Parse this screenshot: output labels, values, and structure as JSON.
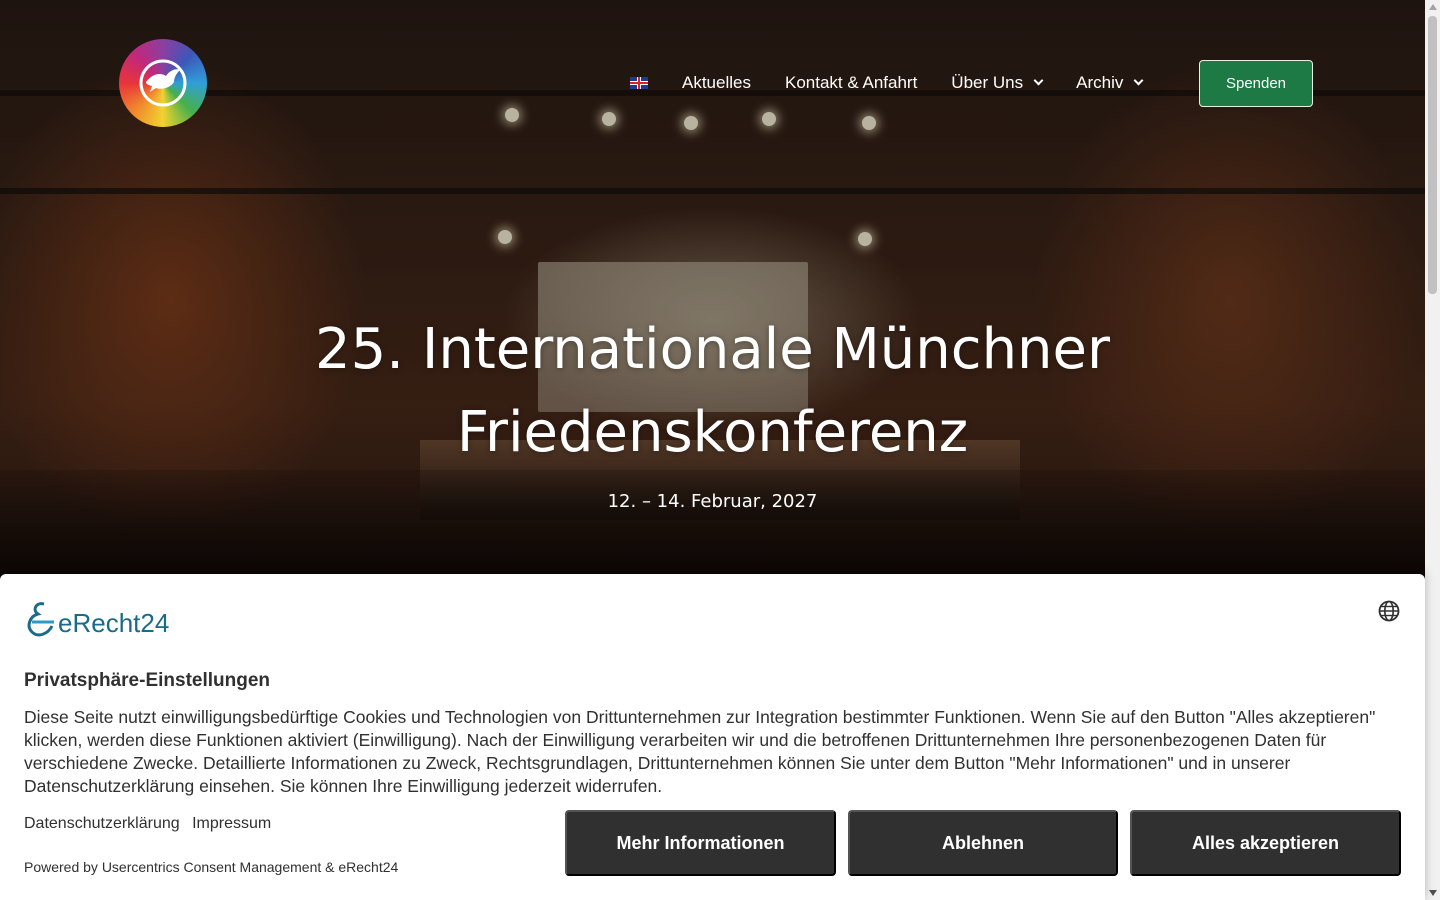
{
  "header": {
    "logo_icon": "peace-dove-logo-icon",
    "language_flag_icon": "uk-flag-icon",
    "nav": [
      {
        "label": "Aktuelles",
        "has_dropdown": false
      },
      {
        "label": "Kontakt & Anfahrt",
        "has_dropdown": false
      },
      {
        "label": "Über Uns",
        "has_dropdown": true
      },
      {
        "label": "Archiv",
        "has_dropdown": true
      }
    ],
    "donate_label": "Spenden"
  },
  "hero": {
    "title_line1": "25. Internationale Münchner",
    "title_line2": "Friedenskonferenz",
    "date": "12. – 14. Februar, 2027"
  },
  "consent": {
    "brand_name": "eRecht24",
    "language_icon": "globe-icon",
    "title": "Privatsphäre-Einstellungen",
    "description": "Diese Seite nutzt einwilligungsbedürftige Cookies und Technologien von Drittunternehmen zur Integration bestimmter Funktionen. Wenn Sie auf den Button \"Alles akzeptieren\" klicken, werden diese Funktionen aktiviert (Einwilligung). Nach der Einwilligung verarbeiten wir und die betroffenen Drittunternehmen Ihre personenbezogenen Daten für verschiedene Zwecke. Detaillierte Informationen zu Zweck, Rechtsgrundlagen, Drittunternehmen können Sie unter dem Button \"Mehr Informationen\" und in unserer Datenschutzerklärung einsehen. Sie können Ihre Einwilligung jederzeit widerrufen.",
    "link_privacy": "Datenschutzerklärung",
    "link_imprint": "Impressum",
    "powered_by": "Powered by Usercentrics Consent Management & eRecht24",
    "btn_more": "Mehr Informationen",
    "btn_decline": "Ablehnen",
    "btn_accept": "Alles akzeptieren"
  },
  "colors": {
    "donate_bg": "#1d7a45",
    "consent_button_bg": "#303030",
    "brand_text": "#1a6b8a"
  }
}
